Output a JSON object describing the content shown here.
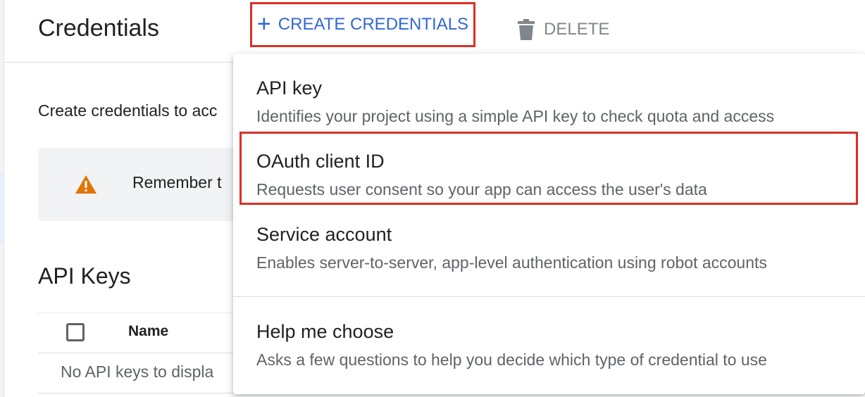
{
  "header": {
    "title": "Credentials",
    "create_button": {
      "label": "CREATE CREDENTIALS",
      "icon": "plus-icon"
    },
    "delete_button": {
      "label": "DELETE",
      "icon": "trash-icon"
    }
  },
  "main": {
    "intro_text": "Create credentials to acc",
    "notice": {
      "icon": "warning-icon",
      "text": "Remember t"
    },
    "api_keys_section": {
      "title": "API Keys",
      "columns": [
        "Name"
      ],
      "empty_text": "No API keys to displa"
    }
  },
  "dropdown_menu": {
    "items": [
      {
        "title": "API key",
        "description": "Identifies your project using a simple API key to check quota and access"
      },
      {
        "title": "OAuth client ID",
        "description": "Requests user consent so your app can access the user's data"
      },
      {
        "title": "Service account",
        "description": "Enables server-to-server, app-level authentication using robot accounts"
      },
      {
        "title": "Help me choose",
        "description": "Asks a few questions to help you decide which type of credential to use"
      }
    ]
  },
  "colors": {
    "accent": "#3367d6",
    "highlight": "#d93025",
    "warning": "#e37400"
  }
}
